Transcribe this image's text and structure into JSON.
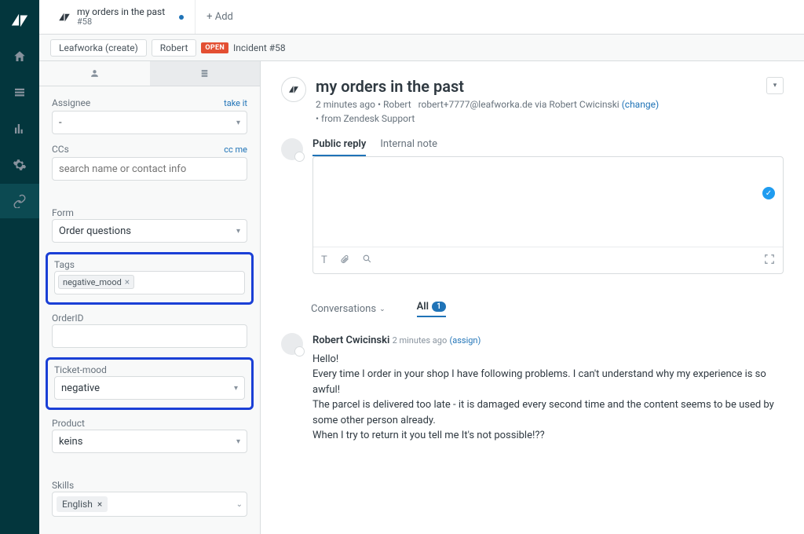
{
  "tabbar": {
    "tab_title": "my orders in the past",
    "tab_sub": "#58",
    "add_label": "+ Add"
  },
  "crumb": {
    "org": "Leafworka (create)",
    "user": "Robert",
    "open": "OPEN",
    "incident": "Incident #58"
  },
  "sidebar": {
    "assignee_label": "Assignee",
    "take_it": "take it",
    "assignee_value": "-",
    "ccs_label": "CCs",
    "cc_me": "cc me",
    "ccs_placeholder": "search name or contact info",
    "form_label": "Form",
    "form_value": "Order questions",
    "tags_label": "Tags",
    "tag_value": "negative_mood",
    "orderid_label": "OrderID",
    "mood_label": "Ticket-mood",
    "mood_value": "negative",
    "product_label": "Product",
    "product_value": "keins",
    "skills_label": "Skills",
    "skill_value": "English"
  },
  "header": {
    "title": "my orders in the past",
    "meta1_time": "2 minutes ago",
    "meta1_user": "Robert",
    "meta1_email": "robert+7777@leafworka.de via Robert Cwicinski",
    "meta1_change": "(change)",
    "meta2": "• from Zendesk Support"
  },
  "compose": {
    "tab_public": "Public reply",
    "tab_internal": "Internal note"
  },
  "filters": {
    "conversations": "Conversations",
    "all": "All",
    "count": "1"
  },
  "message": {
    "author": "Robert Cwicinski",
    "time": "2 minutes ago",
    "assign": "(assign)",
    "line1": "Hello!",
    "line2": "Every time I order in your shop I have following problems. I can't understand why my experience is so awful!",
    "line3": "The parcel is delivered too late - it is damaged every second time and the content seems to be used by some other person already.",
    "line4": "When I try to return it you tell me It's not possible!??"
  }
}
